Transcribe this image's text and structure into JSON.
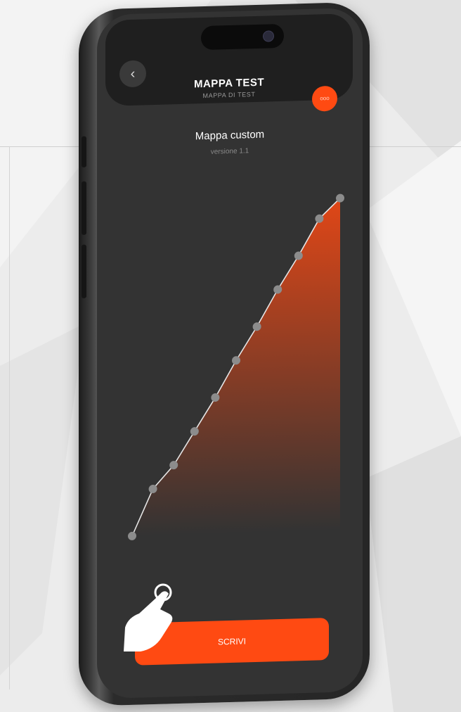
{
  "app": {
    "title": "MAPPA TEST",
    "subtitle": "MAPPA DI TEST",
    "back_icon": "chevron-left-icon",
    "more_label": "ooo"
  },
  "map": {
    "name": "Mappa custom",
    "version": "versione 1.1"
  },
  "chart_data": {
    "type": "line",
    "title": "",
    "xlabel": "",
    "ylabel": "",
    "x": [
      0,
      1,
      2,
      3,
      4,
      5,
      6,
      7,
      8,
      9,
      10
    ],
    "series": [
      {
        "values": [
          0,
          14,
          21,
          31,
          41,
          52,
          62,
          73,
          83,
          94,
          100
        ]
      }
    ],
    "xlim": [
      0,
      10
    ],
    "ylim": [
      0,
      100
    ],
    "grid": false,
    "colors": {
      "line": "#e6e6e6",
      "point": "#8c8c8c",
      "fill": "#ff4a12"
    }
  },
  "actions": {
    "write_label": "SCRIVI"
  },
  "colors": {
    "accent": "#ff4a12",
    "screen_bg": "#333333",
    "header_bg": "#1f1f1f"
  }
}
